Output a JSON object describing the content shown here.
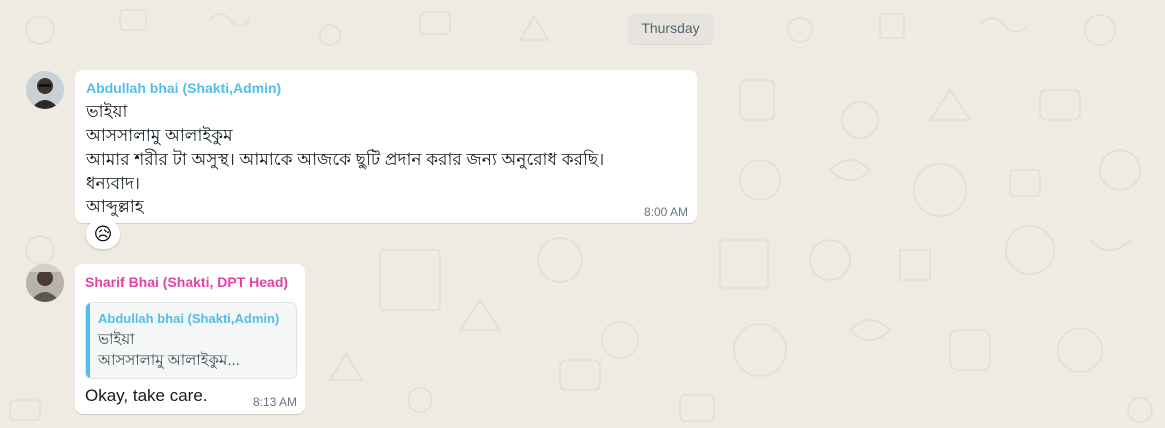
{
  "date_divider": "Thursday",
  "colors": {
    "background": "#efeae2",
    "sender1": "#53bdeb",
    "sender2": "#e542a3",
    "bubble": "#ffffff"
  },
  "messages": [
    {
      "sender": "Abdullah bhai (Shakti,Admin)",
      "lines": [
        "ভাইয়া",
        "আসসালামু আলাইকুম",
        "আমার শরীর টা অসুস্থ।  আমাকে আজকে ছুটি প্রদান করার জন্য অনুরোধ করছি।",
        "ধন্যবাদ।",
        "আব্দুল্লাহ"
      ],
      "time": "8:00 AM",
      "reaction": "😥"
    },
    {
      "sender": "Sharif Bhai (Shakti, DPT Head)",
      "quote": {
        "sender": "Abdullah bhai (Shakti,Admin)",
        "line1": "ভাইয়া",
        "line2": "আসসালামু আলাইকুম..."
      },
      "text": "Okay,  take care.",
      "time": "8:13 AM"
    }
  ]
}
